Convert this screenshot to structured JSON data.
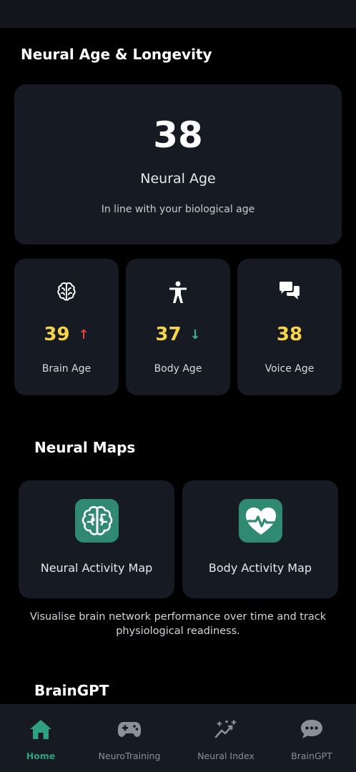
{
  "longevity": {
    "title": "Neural Age & Longevity",
    "neural_age": "38",
    "neural_age_label": "Neural Age",
    "neural_age_note": "In line with your biological age",
    "cards": [
      {
        "icon": "brain-outline-icon",
        "value": "39",
        "trend": "up",
        "trend_glyph": "↑",
        "label": "Brain Age"
      },
      {
        "icon": "person-icon",
        "value": "37",
        "trend": "down",
        "trend_glyph": "↓",
        "label": "Body Age"
      },
      {
        "icon": "chat-bubbles-icon",
        "value": "38",
        "trend": "none",
        "label": "Voice Age"
      }
    ]
  },
  "neural_maps": {
    "title": "Neural Maps",
    "maps": [
      {
        "icon": "brain-map-icon",
        "label": "Neural Activity Map"
      },
      {
        "icon": "heart-pulse-icon",
        "label": "Body Activity Map"
      }
    ],
    "description": "Visualise brain network performance over time and track physiological readiness."
  },
  "braingpt": {
    "title": "BrainGPT"
  },
  "nav": {
    "items": [
      {
        "icon": "home-icon",
        "label": "Home",
        "active": true
      },
      {
        "icon": "gamepad-icon",
        "label": "NeuroTraining",
        "active": false
      },
      {
        "icon": "sparkle-chart-icon",
        "label": "Neural Index",
        "active": false
      },
      {
        "icon": "chat-dots-icon",
        "label": "BrainGPT",
        "active": false
      }
    ]
  },
  "colors": {
    "background": "#000000",
    "card": "#161a22",
    "value_yellow": "#f6d34c",
    "trend_up": "#e0443f",
    "trend_down": "#3fae93",
    "accent_green": "#2fa07f",
    "nav_inactive": "#8a8f98"
  }
}
